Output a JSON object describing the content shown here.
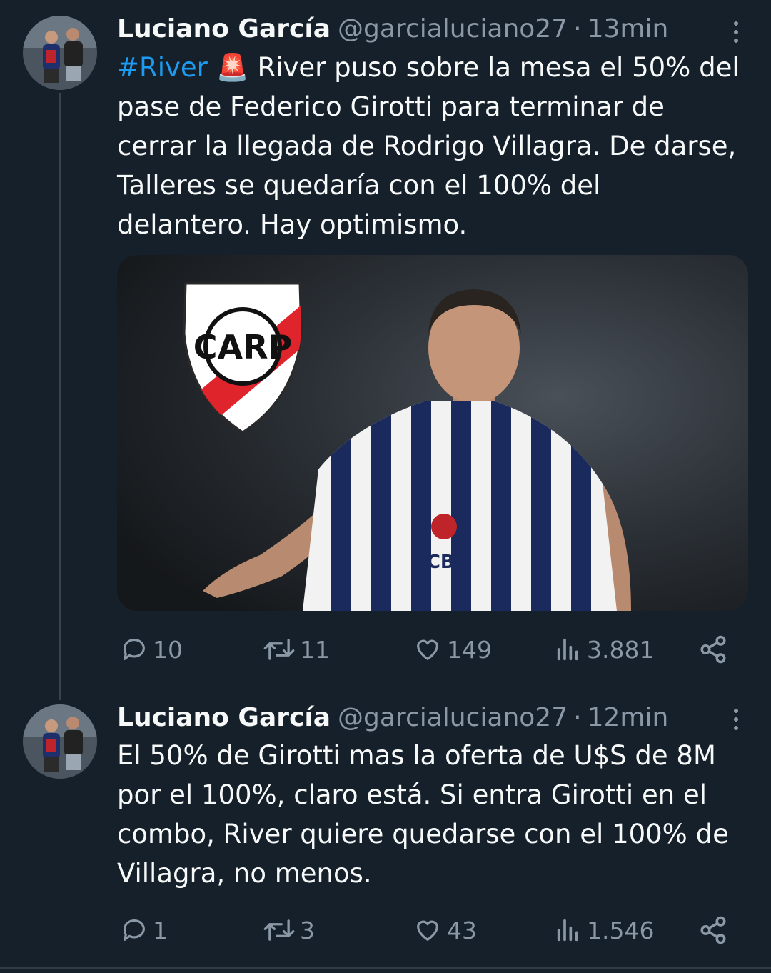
{
  "tweets": [
    {
      "author": "Luciano García",
      "handle": "@garcialuciano27",
      "separator": "·",
      "time": "13min",
      "hashtag": "#River",
      "emoji": "🚨",
      "text": "River puso sobre la mesa el 50% del\npase de Federico Girotti para terminar de\ncerrar la llegada de Rodrigo Villagra. De darse,\nTalleres se quedaría con el 100% del\ndelantero. Hay optimismo.",
      "media": {
        "type": "photo",
        "crest_text": "CARP",
        "jersey_sponsor": "ICBC",
        "club_colors": {
          "crest_red": "#e0242b",
          "stripe_navy": "#1a2a5c",
          "stripe_white": "#f2f2f2"
        }
      },
      "stats": {
        "replies": "10",
        "retweets": "11",
        "likes": "149",
        "views": "3.881"
      }
    },
    {
      "author": "Luciano García",
      "handle": "@garcialuciano27",
      "separator": "·",
      "time": "12min",
      "text": "El 50% de Girotti mas la oferta de U$S de 8M\npor el 100%, claro está. Si entra Girotti en el\ncombo, River quiere quedarse con el 100% de\nVillagra, no menos.",
      "stats": {
        "replies": "1",
        "retweets": "3",
        "likes": "43",
        "views": "1.546"
      }
    }
  ],
  "icons": [
    "reply-icon",
    "retweet-icon",
    "like-icon",
    "views-icon",
    "share-icon",
    "more-icon"
  ],
  "colors": {
    "background": "#15202b",
    "text": "#f7f9f9",
    "secondary": "#8b98a5",
    "link": "#1d9bf0"
  }
}
